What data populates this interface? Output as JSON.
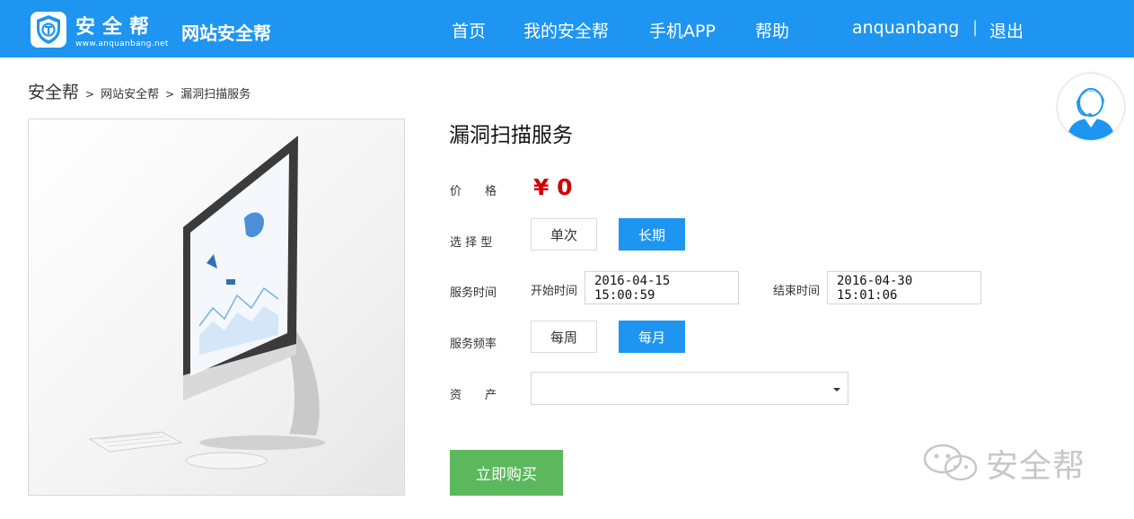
{
  "header": {
    "logo_name": "安全帮",
    "logo_domain": "www.anquanbang.net",
    "site_title": "网站安全帮",
    "nav": [
      "首页",
      "我的安全帮",
      "手机APP",
      "帮助"
    ],
    "username": "anquanbang",
    "separator": "|",
    "logout": "退出"
  },
  "breadcrumb": {
    "home": "安全帮",
    "arrow": ">",
    "items": [
      "网站安全帮",
      "漏洞扫描服务"
    ]
  },
  "product": {
    "title": "漏洞扫描服务",
    "price_label": "价　　格",
    "price": "¥ 0",
    "type_label": "选 择 型",
    "type_options": [
      "单次",
      "长期"
    ],
    "type_selected": "长期",
    "time_label": "服务时间",
    "start_label": "开始时间",
    "start_value": "2016-04-15 15:00:59",
    "end_label": "结束时间",
    "end_value": "2016-04-30 15:01:06",
    "freq_label": "服务频率",
    "freq_options": [
      "每周",
      "每月"
    ],
    "freq_selected": "每月",
    "asset_label": "资　　产",
    "asset_value": "",
    "buy_label": "立即购买"
  },
  "watermark": "安全帮",
  "colors": {
    "brand_blue": "#1e95f0",
    "price_red": "#d20000",
    "buy_green": "#5cb85c"
  },
  "icons": [
    "shield-logo-icon",
    "customer-service-avatar-icon",
    "wechat-icon",
    "dropdown-caret-icon"
  ]
}
